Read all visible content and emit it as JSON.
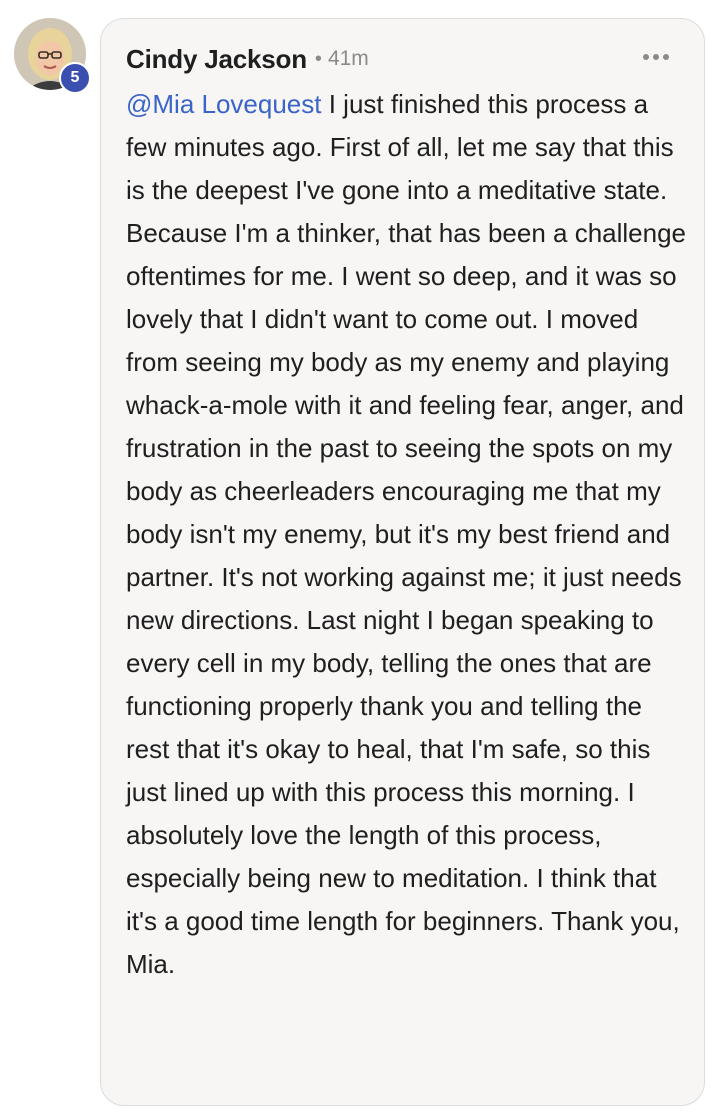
{
  "comment": {
    "author": {
      "name": "Cindy Jackson",
      "avatar_icon": "profile-photo",
      "level_badge": "5",
      "badge_color": "#3b4fb0"
    },
    "separator": "•",
    "timestamp": "41m",
    "more_icon": "more-horizontal-icon",
    "mention": "@Mia Lovequest",
    "mention_color": "#3b64c8",
    "body_text": "I just finished this process a few minutes ago. First of all, let me say that this is the deepest I've gone into a meditative state. Because I'm a thinker, that has been a challenge oftentimes for me. I went so deep, and it was so lovely that I didn't want to come out. I moved from seeing my body as my enemy and playing whack-a-mole with it and feeling fear, anger, and frustration in the past to seeing the spots on my body as cheerleaders encouraging me that my body isn't my enemy, but it's my best friend and partner. It's not working against me; it just needs new directions. Last night I began speaking to every cell in my body, telling the ones that are functioning properly thank you and telling the rest that it's okay to heal, that I'm safe, so this just lined up with this process this morning. I absolutely love the length of this process, especially being new to meditation. I think that it's a good time length for beginners. Thank you, Mia."
  }
}
